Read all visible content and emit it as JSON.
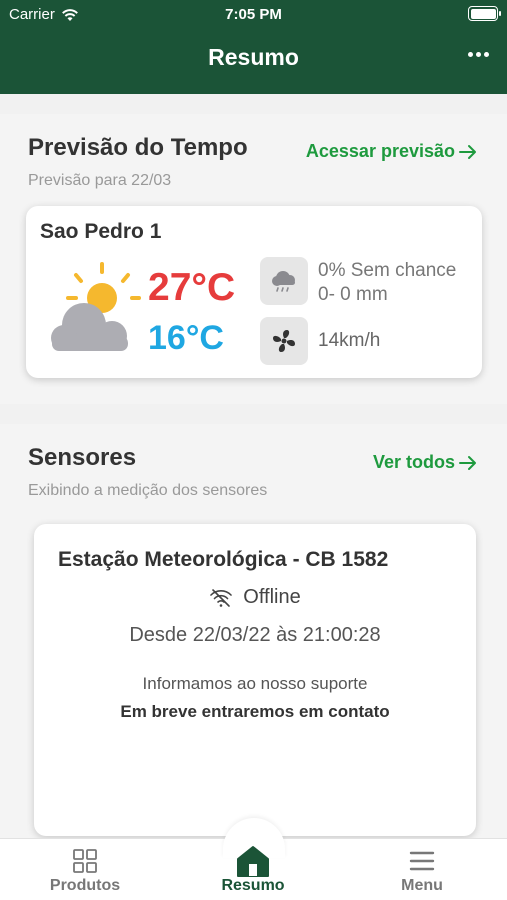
{
  "status_bar": {
    "carrier": "Carrier",
    "time": "7:05 PM"
  },
  "header": {
    "title": "Resumo"
  },
  "weather": {
    "title": "Previsão do Tempo",
    "subtitle": "Previsão para 22/03",
    "link": "Acessar previsão",
    "location": "Sao Pedro 1",
    "temp_max": "27°C",
    "temp_min": "16°C",
    "rain_chance": "0% Sem chance",
    "rain_amount": "0- 0 mm",
    "wind": "14km/h",
    "colors": {
      "max": "#e63c3c",
      "min": "#1fa7e2",
      "link": "#1e9a3e"
    }
  },
  "sensors": {
    "title": "Sensores",
    "subtitle": "Exibindo a medição dos sensores",
    "link": "Ver todos",
    "station": "Estação Meteorológica - CB 1582",
    "status": "Offline",
    "since": "Desde 22/03/22 às 21:00:28",
    "info": "Informamos ao nosso suporte",
    "contact": "Em breve entraremos em contato"
  },
  "tabbar": {
    "items": [
      {
        "label": "Produtos",
        "icon": "grid-icon"
      },
      {
        "label": "Resumo",
        "icon": "home-icon",
        "active": true
      },
      {
        "label": "Menu",
        "icon": "menu-icon"
      }
    ]
  },
  "colors": {
    "header": "#1b5437",
    "accent": "#1e9a3e"
  }
}
